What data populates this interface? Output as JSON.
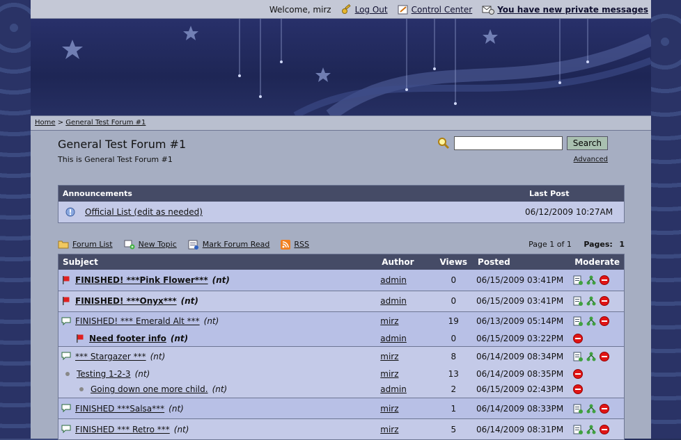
{
  "topbar": {
    "welcome": "Welcome, mirz",
    "logout": "Log Out",
    "control_center": "Control Center",
    "pm": "You have new private messages"
  },
  "breadcrumb": {
    "home": "Home",
    "sep": ">",
    "current": "General Test Forum #1"
  },
  "forum": {
    "title": "General Test Forum #1",
    "description": "This is General Test Forum #1",
    "search_button": "Search",
    "advanced": "Advanced"
  },
  "announcements": {
    "header_title": "Announcements",
    "header_last": "Last Post",
    "item_title": "Official List (edit as needed)",
    "item_date": "06/12/2009 10:27AM"
  },
  "toolbar": {
    "forum_list": "Forum List",
    "new_topic": "New Topic",
    "mark_read": "Mark Forum Read",
    "rss": "RSS",
    "page_info": "Page 1 of 1",
    "pages_label": "Pages:",
    "pages_value": "1"
  },
  "columns": {
    "subject": "Subject",
    "author": "Author",
    "views": "Views",
    "posted": "Posted",
    "moderate": "Moderate"
  },
  "rows": [
    {
      "subject": "FINISHED! ***Pink Flower***",
      "nt": "(nt)",
      "author": "admin",
      "views": "0",
      "posted": "06/15/2009 03:41PM"
    },
    {
      "subject": "FINISHED! ***Onyx***",
      "nt": "(nt)",
      "author": "admin",
      "views": "0",
      "posted": "06/15/2009 03:41PM"
    },
    {
      "subject": "FINISHED! *** Emerald Alt ***",
      "nt": "(nt)",
      "author": "mirz",
      "views": "19",
      "posted": "06/13/2009 05:14PM"
    },
    {
      "subject": "Need footer info",
      "nt": "(nt)",
      "author": "admin",
      "views": "0",
      "posted": "06/15/2009 03:22PM"
    },
    {
      "subject": "*** Stargazer ***",
      "nt": "(nt)",
      "author": "mirz",
      "views": "8",
      "posted": "06/14/2009 08:34PM"
    },
    {
      "subject": "Testing 1-2-3",
      "nt": "(nt)",
      "author": "mirz",
      "views": "13",
      "posted": "06/14/2009 08:35PM"
    },
    {
      "subject": "Going down one more child.",
      "nt": "(nt)",
      "author": "admin",
      "views": "2",
      "posted": "06/15/2009 02:43PM"
    },
    {
      "subject": "FINISHED ***Salsa***",
      "nt": "(nt)",
      "author": "mirz",
      "views": "1",
      "posted": "06/14/2009 08:33PM"
    },
    {
      "subject": "FINISHED *** Retro ***",
      "nt": "(nt)",
      "author": "mirz",
      "views": "5",
      "posted": "06/14/2009 08:31PM"
    }
  ]
}
